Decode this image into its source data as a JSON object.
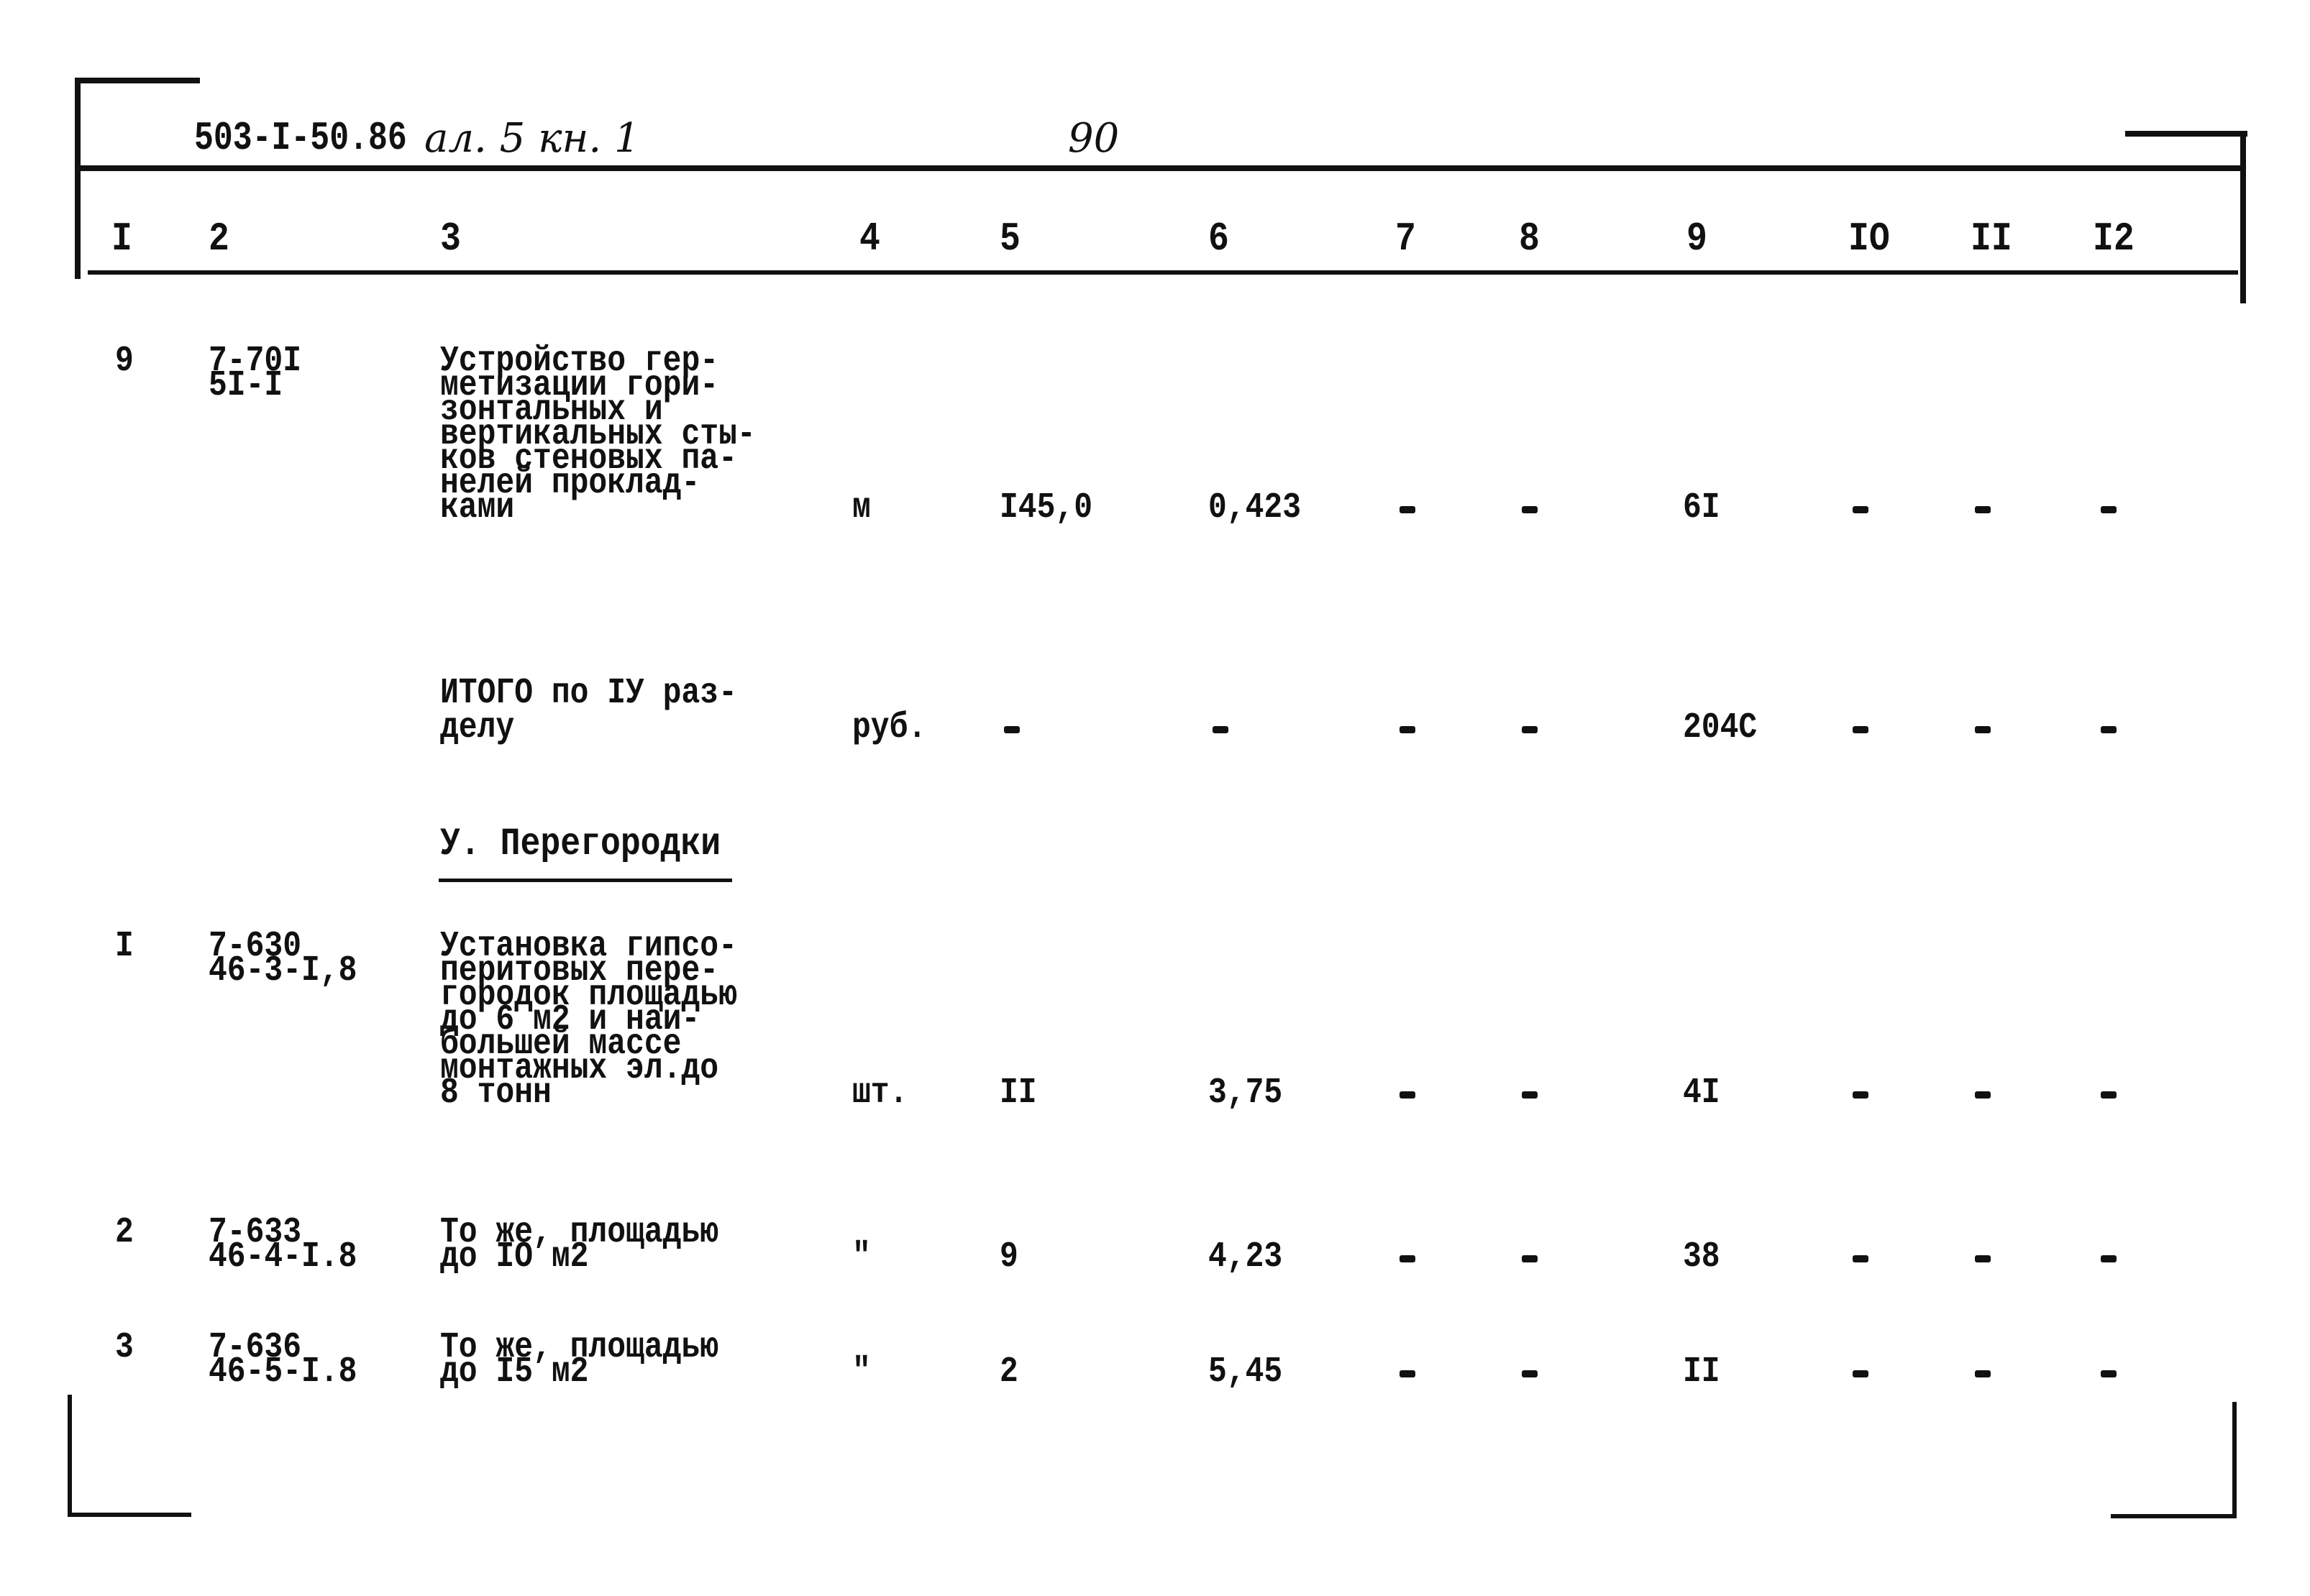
{
  "header": {
    "doc_code": "503-I-50.86",
    "handwritten_ref": "ал. 5 кн. 1",
    "page_number": "90"
  },
  "columns": [
    "I",
    "2",
    "3",
    "4",
    "5",
    "6",
    "7",
    "8",
    "9",
    "IO",
    "II",
    "I2"
  ],
  "rows": [
    {
      "num": "9",
      "code": [
        "7-70I",
        "5I-I"
      ],
      "description": [
        "Устройство гер-",
        "метизации гори-",
        "зонтальных и",
        "вертикальных сты-",
        "ков стеновых па-",
        "нелей проклад-",
        "ками"
      ],
      "unit": "м",
      "c5": "I45,0",
      "c6": "0,423",
      "c7": "-",
      "c8": "-",
      "c9": "6I",
      "c10": "-",
      "c11": "-",
      "c12": "-"
    },
    {
      "num": "",
      "code": [],
      "description": [
        "ИТОГО по IУ раз-",
        "делу"
      ],
      "unit": "руб.",
      "c5": "-",
      "c6": "-",
      "c7": "-",
      "c8": "-",
      "c9": "204C",
      "c10": "-",
      "c11": "-",
      "c12": "-"
    }
  ],
  "section_title": "У. Перегородки",
  "section_rows": [
    {
      "num": "I",
      "code": [
        "7-630",
        "46-3-I,8"
      ],
      "description": [
        "Установка гипсо-",
        "перитовых пере-",
        "городок площадью",
        "до 6 м2 и наи-",
        "большей массе",
        "монтажных эл.до",
        "8 тонн"
      ],
      "unit": "шт.",
      "c5": "II",
      "c6": "3,75",
      "c7": "-",
      "c8": "-",
      "c9": "4I",
      "c10": "-",
      "c11": "-",
      "c12": "-"
    },
    {
      "num": "2",
      "code": [
        "7-633",
        "46-4-I.8"
      ],
      "description": [
        "То же, площадью",
        "до IO м2"
      ],
      "unit": "\"",
      "c5": "9",
      "c6": "4,23",
      "c7": "-",
      "c8": "-",
      "c9": "38",
      "c10": "-",
      "c11": "-",
      "c12": "-"
    },
    {
      "num": "3",
      "code": [
        "7-636",
        "46-5-I.8"
      ],
      "description": [
        "То же, площадью",
        "до I5 м2"
      ],
      "unit": "\"",
      "c5": "2",
      "c6": "5,45",
      "c7": "-",
      "c8": "-",
      "c9": "II",
      "c10": "-",
      "c11": "-",
      "c12": "-"
    }
  ]
}
